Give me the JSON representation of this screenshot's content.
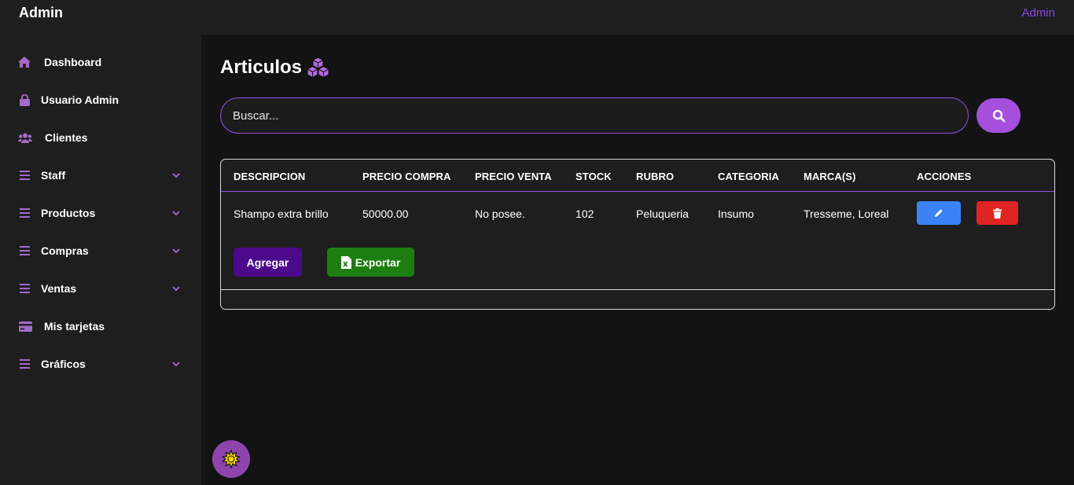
{
  "header": {
    "brand": "Admin",
    "user_label": "Admin"
  },
  "sidebar": {
    "items": [
      {
        "label": "Dashboard",
        "icon": "home-icon",
        "expandable": false
      },
      {
        "label": "Usuario Admin",
        "icon": "lock-icon",
        "expandable": false
      },
      {
        "label": "Clientes",
        "icon": "users-icon",
        "expandable": false
      },
      {
        "label": "Staff",
        "icon": "menu-icon",
        "expandable": true
      },
      {
        "label": "Productos",
        "icon": "menu-icon",
        "expandable": true
      },
      {
        "label": "Compras",
        "icon": "menu-icon",
        "expandable": true
      },
      {
        "label": "Ventas",
        "icon": "menu-icon",
        "expandable": true
      },
      {
        "label": "Mis tarjetas",
        "icon": "credit-card-icon",
        "expandable": false
      },
      {
        "label": "Gráficos",
        "icon": "menu-icon",
        "expandable": true
      }
    ]
  },
  "main": {
    "title": "Articulos",
    "title_icon": "cubes-icon",
    "search": {
      "placeholder": "Buscar...",
      "value": ""
    },
    "table": {
      "columns": [
        "DESCRIPCION",
        "PRECIO COMPRA",
        "PRECIO VENTA",
        "STOCK",
        "RUBRO",
        "CATEGORIA",
        "MARCA(S)",
        "ACCIONES"
      ],
      "rows": [
        {
          "descripcion": "Shampo extra brillo",
          "precio_compra": "50000.00",
          "precio_venta": "No posee.",
          "stock": "102",
          "rubro": "Peluqueria",
          "categoria": "Insumo",
          "marcas": "Tresseme, Loreal"
        }
      ]
    },
    "actions": {
      "add_label": "Agregar",
      "export_label": "Exportar"
    }
  },
  "colors": {
    "accent": "#8b45ea",
    "sidebar_icon": "#a46bc9",
    "search_button": "#a54fdc",
    "edit": "#3b82f6",
    "delete": "#e02424",
    "add": "#4b0a8c",
    "export": "#1d7e10",
    "theme_toggle": "#8e44ad"
  }
}
